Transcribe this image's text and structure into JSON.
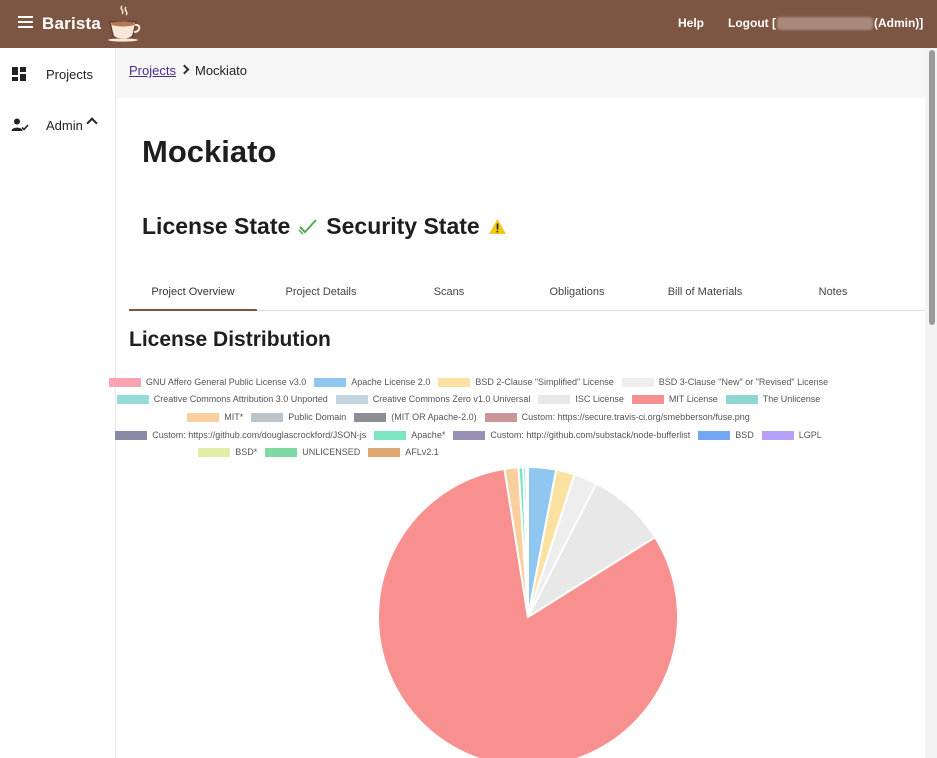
{
  "header": {
    "brand": "Barista",
    "help": "Help",
    "logout_prefix": "Logout [",
    "logout_suffix": "(Admin)]",
    "background": "#7d5543"
  },
  "sidebar": {
    "items": [
      {
        "label": "Projects",
        "icon": "dashboard-icon"
      },
      {
        "label": "Admin",
        "icon": "user-check-icon"
      }
    ]
  },
  "breadcrumb": {
    "parent": "Projects",
    "current": "Mockiato"
  },
  "project": {
    "title": "Mockiato",
    "license_state_label": "License State",
    "security_state_label": "Security State",
    "license_state_icon": "check-icon",
    "security_state_icon": "warning-icon"
  },
  "tabs": [
    "Project Overview",
    "Project Details",
    "Scans",
    "Obligations",
    "Bill of Materials",
    "Notes"
  ],
  "section": {
    "title": "License Distribution"
  },
  "chart_data": {
    "type": "pie",
    "title": "",
    "series": [
      {
        "name": "GNU Affero General Public License v3.0",
        "value": 0,
        "color": "#f9a3b3"
      },
      {
        "name": "Apache License 2.0",
        "value": 3,
        "color": "#8fc7f1"
      },
      {
        "name": "BSD 2-Clause \"Simplified\" License",
        "value": 2,
        "color": "#fbe2a0"
      },
      {
        "name": "BSD 3-Clause \"New\" or \"Revised\" License",
        "value": 2.5,
        "color": "#eeeeee"
      },
      {
        "name": "Creative Commons Attribution 3.0 Unported",
        "value": 0,
        "color": "#95dcd8"
      },
      {
        "name": "Creative Commons Zero v1.0 Universal",
        "value": 0,
        "color": "#c3d5e0"
      },
      {
        "name": "ISC License",
        "value": 8.5,
        "color": "#e8e8e8"
      },
      {
        "name": "MIT License",
        "value": 81,
        "color": "#f89090"
      },
      {
        "name": "The Unlicense",
        "value": 0,
        "color": "#8fd8d2"
      },
      {
        "name": "MIT*",
        "value": 1.5,
        "color": "#f9cf9d"
      },
      {
        "name": "Public Domain",
        "value": 0,
        "color": "#bbc3cb"
      },
      {
        "name": "(MIT OR Apache-2.0)",
        "value": 0,
        "color": "#8e8e96"
      },
      {
        "name": "Custom: https://secure.travis-ci.org/smebberson/fuse.png",
        "value": 0,
        "color": "#c99596"
      },
      {
        "name": "Custom: https://github.com/douglascrockford/JSON-js",
        "value": 0,
        "color": "#8b8aa6"
      },
      {
        "name": "Apache*",
        "value": 0.5,
        "color": "#7de5c4"
      },
      {
        "name": "Custom: http://github.com/substack/node-bufferlist",
        "value": 0,
        "color": "#9a90b5"
      },
      {
        "name": "BSD",
        "value": 0,
        "color": "#74a8f5"
      },
      {
        "name": "LGPL",
        "value": 0,
        "color": "#b6a0f9"
      },
      {
        "name": "BSD*",
        "value": 0,
        "color": "#e2eda7"
      },
      {
        "name": "UNLICENSED",
        "value": 0.3,
        "color": "#7ed9a2"
      },
      {
        "name": "AFLv2.1",
        "value": 0.2,
        "color": "#e0a873"
      }
    ],
    "legend": "top"
  }
}
